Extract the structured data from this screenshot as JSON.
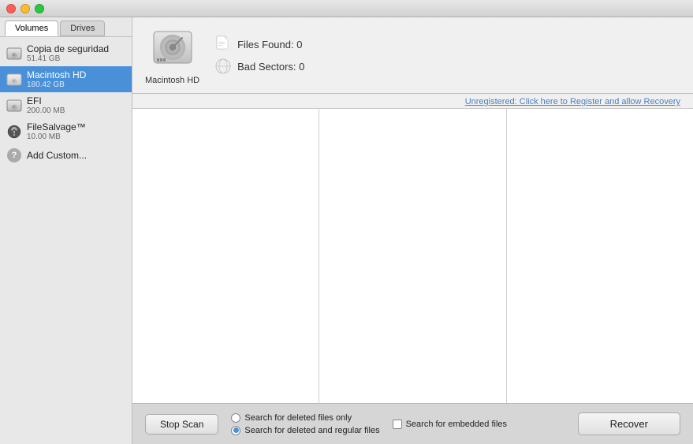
{
  "titlebar": {
    "traffic_lights": [
      "close",
      "minimize",
      "maximize"
    ]
  },
  "sidebar": {
    "tabs": [
      {
        "id": "volumes",
        "label": "Volumes",
        "active": true
      },
      {
        "id": "drives",
        "label": "Drives",
        "active": false
      }
    ],
    "items": [
      {
        "id": "copia",
        "name": "Copia de seguridad",
        "subtext": "51.41 GB",
        "icon": "hd",
        "selected": false
      },
      {
        "id": "macintosh-hd",
        "name": "Macintosh HD",
        "subtext": "180.42 GB",
        "icon": "hd",
        "selected": true
      },
      {
        "id": "efi",
        "name": "EFI",
        "subtext": "200.00 MB",
        "icon": "hd",
        "selected": false
      },
      {
        "id": "filesalvage",
        "name": "FileSalvage™",
        "subtext": "10.00 MB",
        "icon": "gear",
        "selected": false
      },
      {
        "id": "add-custom",
        "name": "Add Custom...",
        "subtext": "",
        "icon": "question",
        "selected": false
      }
    ]
  },
  "info_panel": {
    "drive_label": "Macintosh HD",
    "files_found_label": "Files Found:",
    "files_found_value": "0",
    "bad_sectors_label": "Bad Sectors:",
    "bad_sectors_value": "0"
  },
  "register_bar": {
    "link_text": "Unregistered: Click here to Register and allow Recovery"
  },
  "bottom_bar": {
    "stop_scan_label": "Stop Scan",
    "recover_label": "Recover",
    "radio_options": [
      {
        "id": "deleted-only",
        "label": "Search for deleted files only",
        "checked": false
      },
      {
        "id": "deleted-regular",
        "label": "Search for deleted and regular files",
        "checked": true
      }
    ],
    "checkbox_options": [
      {
        "id": "embedded",
        "label": "Search for embedded files",
        "checked": false
      }
    ]
  }
}
